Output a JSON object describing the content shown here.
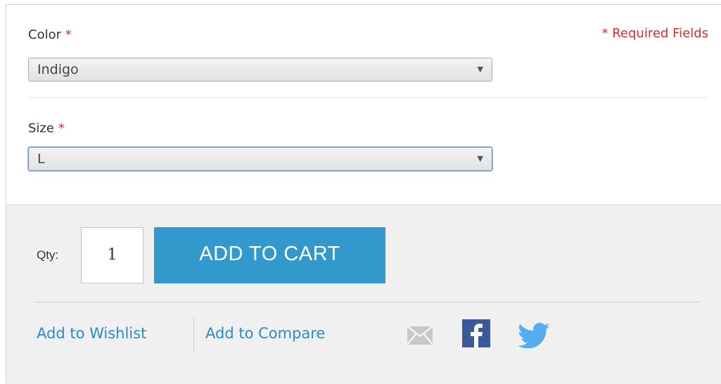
{
  "options": {
    "color": {
      "label": "Color",
      "required_mark": "*",
      "selected": "Indigo"
    },
    "size": {
      "label": "Size",
      "required_mark": "*",
      "selected": "L"
    },
    "required_note": "* Required Fields"
  },
  "cart": {
    "qty_label": "Qty:",
    "qty_value": "1",
    "add_to_cart_label": "ADD TO CART"
  },
  "links": {
    "wishlist": "Add to Wishlist",
    "compare": "Add to Compare"
  },
  "social": {
    "icons": [
      "email-icon",
      "facebook-icon",
      "twitter-icon"
    ]
  },
  "colors": {
    "required": "#e02b27",
    "button": "#3399cc",
    "link": "#2e8bc6",
    "facebook": "#3b5998",
    "twitter": "#55acee",
    "email": "#c8c8c8"
  }
}
